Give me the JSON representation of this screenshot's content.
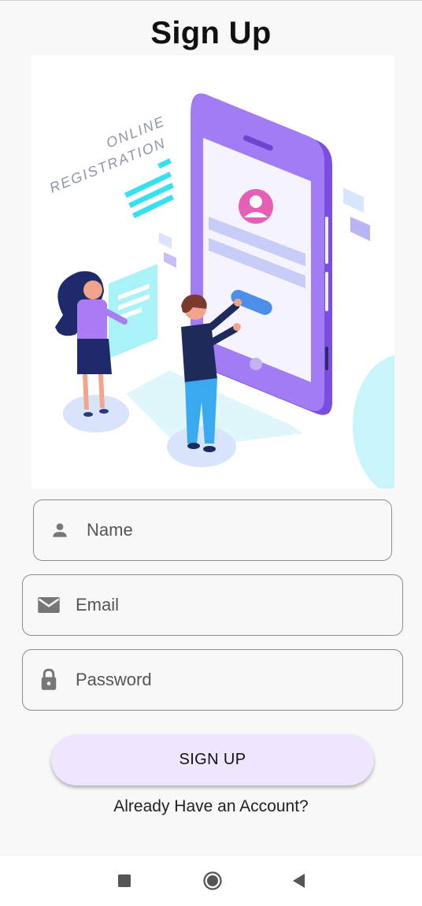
{
  "page": {
    "title": "Sign Up"
  },
  "illustration": {
    "caption_line1": "ONLINE",
    "caption_line2": "REGISTRATION"
  },
  "form": {
    "name": {
      "placeholder": "Name",
      "icon": "person-icon"
    },
    "email": {
      "placeholder": "Email",
      "icon": "mail-icon"
    },
    "password": {
      "placeholder": "Password",
      "icon": "lock-icon"
    }
  },
  "actions": {
    "signup_label": "SIGN UP",
    "login_link": "Already Have an Account?"
  },
  "navbar": {
    "icons": [
      "recents-square-icon",
      "home-circle-icon",
      "back-triangle-icon"
    ]
  },
  "colors": {
    "background": "#f8f8f8",
    "button_bg": "#efe6fd",
    "field_border": "#8c8c8c",
    "icon_gray": "#777777",
    "phone_purple": "#8f63f0",
    "accent_cyan": "#35e0f0"
  }
}
